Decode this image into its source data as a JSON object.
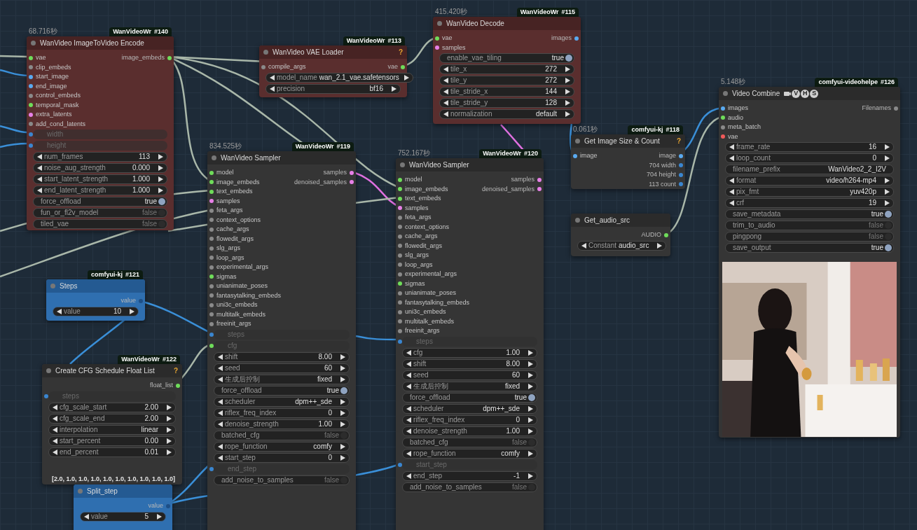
{
  "nodes": [
    {
      "title": "WanVideo ImageToVideo Encode",
      "time": "68.716秒",
      "badge": {
        "source": "WanVideoWr",
        "id": "#140"
      },
      "kind": "red",
      "inputs": [
        {
          "label": "vae",
          "color": "#6fdc5a"
        },
        {
          "label": "clip_embeds",
          "color": "#8a8a8a"
        },
        {
          "label": "start_image",
          "color": "#5aaaf0"
        },
        {
          "label": "end_image",
          "color": "#5aaaf0"
        },
        {
          "label": "control_embeds",
          "color": "#8a8a8a"
        },
        {
          "label": "temporal_mask",
          "color": "#6fdc5a"
        },
        {
          "label": "extra_latents",
          "color": "#e880e8"
        },
        {
          "label": "add_cond_latents",
          "color": "#8a8a8a"
        }
      ],
      "outputs": [
        {
          "label": "image_embeds",
          "color": "#6fdc5a"
        }
      ],
      "widgets": [
        {
          "kind": "linked",
          "label": "width",
          "color": "#3a86d0"
        },
        {
          "kind": "linked",
          "label": "height",
          "color": "#3a86d0"
        },
        {
          "kind": "number",
          "label": "num_frames",
          "value": "113"
        },
        {
          "kind": "number",
          "label": "noise_aug_strength",
          "value": "0.000"
        },
        {
          "kind": "number",
          "label": "start_latent_strength",
          "value": "1.000"
        },
        {
          "kind": "number",
          "label": "end_latent_strength",
          "value": "1.000"
        },
        {
          "kind": "toggle",
          "label": "force_offload",
          "value": "true",
          "on": true
        },
        {
          "kind": "toggle",
          "label": "fun_or_fl2v_model",
          "value": "false",
          "on": false
        },
        {
          "kind": "toggle",
          "label": "tiled_vae",
          "value": "false",
          "on": false
        }
      ]
    },
    {
      "title": "WanVideo VAE Loader",
      "badge": {
        "source": "WanVideoWr",
        "id": "#113"
      },
      "kind": "red",
      "help_mark": "?",
      "inputs": [
        {
          "label": "compile_args",
          "color": "#8a8a8a"
        }
      ],
      "outputs": [
        {
          "label": "vae",
          "color": "#6fdc5a"
        }
      ],
      "widgets": [
        {
          "kind": "combo",
          "label": "model_name",
          "value": "wan_2.1_vae.safetensors"
        },
        {
          "kind": "combo",
          "label": "precision",
          "value": "bf16"
        }
      ]
    },
    {
      "title": "WanVideo Decode",
      "time": "415.420秒",
      "badge": {
        "source": "WanVideoWr",
        "id": "#115"
      },
      "kind": "red",
      "inputs": [
        {
          "label": "vae",
          "color": "#6fdc5a"
        },
        {
          "label": "samples",
          "color": "#e880e8"
        }
      ],
      "outputs": [
        {
          "label": "images",
          "color": "#5aaaf0"
        }
      ],
      "widgets": [
        {
          "kind": "toggle",
          "label": "enable_vae_tiling",
          "value": "true",
          "on": true
        },
        {
          "kind": "number",
          "label": "tile_x",
          "value": "272"
        },
        {
          "kind": "number",
          "label": "tile_y",
          "value": "272"
        },
        {
          "kind": "number",
          "label": "tile_stride_x",
          "value": "144"
        },
        {
          "kind": "number",
          "label": "tile_stride_y",
          "value": "128"
        },
        {
          "kind": "combo",
          "label": "normalization",
          "value": "default"
        }
      ]
    },
    {
      "title": "Video Combine",
      "title_marks": [
        "V",
        "H",
        "S"
      ],
      "time": "5.148秒",
      "badge": {
        "source": "comfyui-videohelpe",
        "id": "#126"
      },
      "kind": "dark",
      "inputs": [
        {
          "label": "images",
          "color": "#5aaaf0"
        },
        {
          "label": "audio",
          "color": "#6fdc5a"
        },
        {
          "label": "meta_batch",
          "color": "#8a8a8a"
        },
        {
          "label": "vae",
          "color": "#f05a5a"
        }
      ],
      "outputs": [
        {
          "label": "Filenames",
          "color": "#8a8a8a"
        }
      ],
      "widgets": [
        {
          "kind": "number",
          "label": "frame_rate",
          "value": "16"
        },
        {
          "kind": "number",
          "label": "loop_count",
          "value": "0"
        },
        {
          "kind": "text",
          "label": "filename_prefix",
          "value": "WanVideo2_2_I2V"
        },
        {
          "kind": "combo",
          "label": "format",
          "value": "video/h264-mp4"
        },
        {
          "kind": "combo",
          "label": "pix_fmt",
          "value": "yuv420p"
        },
        {
          "kind": "number",
          "label": "crf",
          "value": "19"
        },
        {
          "kind": "toggle",
          "label": "save_metadata",
          "value": "true",
          "on": true
        },
        {
          "kind": "toggle",
          "label": "trim_to_audio",
          "value": "false",
          "on": false
        },
        {
          "kind": "toggle",
          "label": "pingpong",
          "value": "false",
          "on": false
        },
        {
          "kind": "toggle",
          "label": "save_output",
          "value": "true",
          "on": true
        }
      ],
      "preview": {
        "kind": "picture"
      }
    },
    {
      "title": "Get Image Size & Count",
      "time": "0.061秒",
      "badge": {
        "source": "comfyui-kj",
        "id": "#118"
      },
      "kind": "dark",
      "help_mark": "?",
      "inputs": [
        {
          "label": "image",
          "color": "#5aaaf0"
        }
      ],
      "outputs": [
        {
          "label": "image",
          "color": "#5aaaf0"
        },
        {
          "label": "704 width",
          "color": "#3a86d0"
        },
        {
          "label": "704 height",
          "color": "#3a86d0"
        },
        {
          "label": "113 count",
          "color": "#3a86d0"
        }
      ]
    },
    {
      "title": "Get_audio_src",
      "kind": "dark",
      "outputs": [
        {
          "label": "AUDIO",
          "color": "#6fdc5a"
        }
      ],
      "widgets": [
        {
          "kind": "combo",
          "label": "Constant",
          "value": "audio_src"
        }
      ]
    },
    {
      "title": "WanVideo Sampler",
      "time": "834.525秒",
      "badge": {
        "source": "WanVideoWr",
        "id": "#119"
      },
      "kind": "dark",
      "inputs": [
        {
          "label": "model",
          "color": "#6fdc5a"
        },
        {
          "label": "image_embeds",
          "color": "#6fdc5a"
        },
        {
          "label": "text_embeds",
          "color": "#6fdc5a"
        },
        {
          "label": "samples",
          "color": "#e880e8"
        },
        {
          "label": "feta_args",
          "color": "#8a8a8a"
        },
        {
          "label": "context_options",
          "color": "#8a8a8a"
        },
        {
          "label": "cache_args",
          "color": "#8a8a8a"
        },
        {
          "label": "flowedit_args",
          "color": "#8a8a8a"
        },
        {
          "label": "slg_args",
          "color": "#8a8a8a"
        },
        {
          "label": "loop_args",
          "color": "#8a8a8a"
        },
        {
          "label": "experimental_args",
          "color": "#8a8a8a"
        },
        {
          "label": "sigmas",
          "color": "#6fdc5a"
        },
        {
          "label": "unianimate_poses",
          "color": "#8a8a8a"
        },
        {
          "label": "fantasytalking_embeds",
          "color": "#8a8a8a"
        },
        {
          "label": "uni3c_embeds",
          "color": "#8a8a8a"
        },
        {
          "label": "multitalk_embeds",
          "color": "#8a8a8a"
        },
        {
          "label": "freeinit_args",
          "color": "#8a8a8a"
        }
      ],
      "outputs": [
        {
          "label": "samples",
          "color": "#e880e8"
        },
        {
          "label": "denoised_samples",
          "color": "#e880e8"
        }
      ],
      "widgets": [
        {
          "kind": "linked",
          "label": "steps",
          "color": "#3a86d0"
        },
        {
          "kind": "linked",
          "label": "cfg",
          "color": "#6fdc5a"
        },
        {
          "kind": "number",
          "label": "shift",
          "value": "8.00"
        },
        {
          "kind": "number",
          "label": "seed",
          "value": "60"
        },
        {
          "kind": "combo",
          "label": "生成后控制",
          "value": "fixed"
        },
        {
          "kind": "toggle",
          "label": "force_offload",
          "value": "true",
          "on": true
        },
        {
          "kind": "combo",
          "label": "scheduler",
          "value": "dpm++_sde"
        },
        {
          "kind": "number",
          "label": "riflex_freq_index",
          "value": "0"
        },
        {
          "kind": "number",
          "label": "denoise_strength",
          "value": "1.00"
        },
        {
          "kind": "toggle",
          "label": "batched_cfg",
          "value": "false",
          "on": false
        },
        {
          "kind": "combo",
          "label": "rope_function",
          "value": "comfy"
        },
        {
          "kind": "number",
          "label": "start_step",
          "value": "0"
        },
        {
          "kind": "linked",
          "label": "end_step",
          "color": "#3a86d0"
        },
        {
          "kind": "toggle",
          "label": "add_noise_to_samples",
          "value": "false",
          "on": false
        }
      ]
    },
    {
      "title": "WanVideo Sampler",
      "time": "752.167秒",
      "badge": {
        "source": "WanVideoWr",
        "id": "#120"
      },
      "kind": "dark",
      "inputs": [
        {
          "label": "model",
          "color": "#6fdc5a"
        },
        {
          "label": "image_embeds",
          "color": "#6fdc5a"
        },
        {
          "label": "text_embeds",
          "color": "#6fdc5a"
        },
        {
          "label": "samples",
          "color": "#e880e8"
        },
        {
          "label": "feta_args",
          "color": "#8a8a8a"
        },
        {
          "label": "context_options",
          "color": "#8a8a8a"
        },
        {
          "label": "cache_args",
          "color": "#8a8a8a"
        },
        {
          "label": "flowedit_args",
          "color": "#8a8a8a"
        },
        {
          "label": "slg_args",
          "color": "#8a8a8a"
        },
        {
          "label": "loop_args",
          "color": "#8a8a8a"
        },
        {
          "label": "experimental_args",
          "color": "#8a8a8a"
        },
        {
          "label": "sigmas",
          "color": "#6fdc5a"
        },
        {
          "label": "unianimate_poses",
          "color": "#8a8a8a"
        },
        {
          "label": "fantasytalking_embeds",
          "color": "#8a8a8a"
        },
        {
          "label": "uni3c_embeds",
          "color": "#8a8a8a"
        },
        {
          "label": "multitalk_embeds",
          "color": "#8a8a8a"
        },
        {
          "label": "freeinit_args",
          "color": "#8a8a8a"
        }
      ],
      "outputs": [
        {
          "label": "samples",
          "color": "#e880e8"
        },
        {
          "label": "denoised_samples",
          "color": "#e880e8"
        }
      ],
      "widgets": [
        {
          "kind": "linked",
          "label": "steps",
          "color": "#3a86d0"
        },
        {
          "kind": "number",
          "label": "cfg",
          "value": "1.00"
        },
        {
          "kind": "number",
          "label": "shift",
          "value": "8.00"
        },
        {
          "kind": "number",
          "label": "seed",
          "value": "60"
        },
        {
          "kind": "combo",
          "label": "生成后控制",
          "value": "fixed"
        },
        {
          "kind": "toggle",
          "label": "force_offload",
          "value": "true",
          "on": true
        },
        {
          "kind": "combo",
          "label": "scheduler",
          "value": "dpm++_sde"
        },
        {
          "kind": "number",
          "label": "riflex_freq_index",
          "value": "0"
        },
        {
          "kind": "number",
          "label": "denoise_strength",
          "value": "1.00"
        },
        {
          "kind": "toggle",
          "label": "batched_cfg",
          "value": "false",
          "on": false
        },
        {
          "kind": "combo",
          "label": "rope_function",
          "value": "comfy"
        },
        {
          "kind": "linked",
          "label": "start_step",
          "color": "#3a86d0"
        },
        {
          "kind": "number",
          "label": "end_step",
          "value": "-1"
        },
        {
          "kind": "toggle",
          "label": "add_noise_to_samples",
          "value": "false",
          "on": false
        }
      ]
    },
    {
      "title": "Steps",
      "badge": {
        "source": "comfyui-kj",
        "id": "#121"
      },
      "kind": "blue",
      "outputs": [
        {
          "label": "value",
          "color": "#1d4f86"
        }
      ],
      "widgets": [
        {
          "kind": "number",
          "label": "value",
          "value": "10"
        }
      ]
    },
    {
      "title": "Create CFG Schedule Float List",
      "badge": {
        "source": "WanVideoWr",
        "id": "#122"
      },
      "kind": "dark",
      "help_mark": "?",
      "outputs": [
        {
          "label": "float_list",
          "color": "#6fdc5a"
        }
      ],
      "widgets": [
        {
          "kind": "linked",
          "label": "steps",
          "color": "#3a86d0"
        },
        {
          "kind": "number",
          "label": "cfg_scale_start",
          "value": "2.00"
        },
        {
          "kind": "number",
          "label": "cfg_scale_end",
          "value": "2.00"
        },
        {
          "kind": "combo",
          "label": "interpolation",
          "value": "linear"
        },
        {
          "kind": "number",
          "label": "start_percent",
          "value": "0.00"
        },
        {
          "kind": "number",
          "label": "end_percent",
          "value": "0.01"
        }
      ],
      "result": "[2.0, 1.0, 1.0, 1.0, 1.0, 1.0, 1.0, 1.0, 1.0, 1.0]"
    },
    {
      "title": "Split_step",
      "kind": "blue",
      "outputs": [
        {
          "label": "value",
          "color": "#1d4f86"
        }
      ],
      "widgets": [
        {
          "kind": "number",
          "label": "value",
          "value": "5"
        }
      ]
    }
  ]
}
